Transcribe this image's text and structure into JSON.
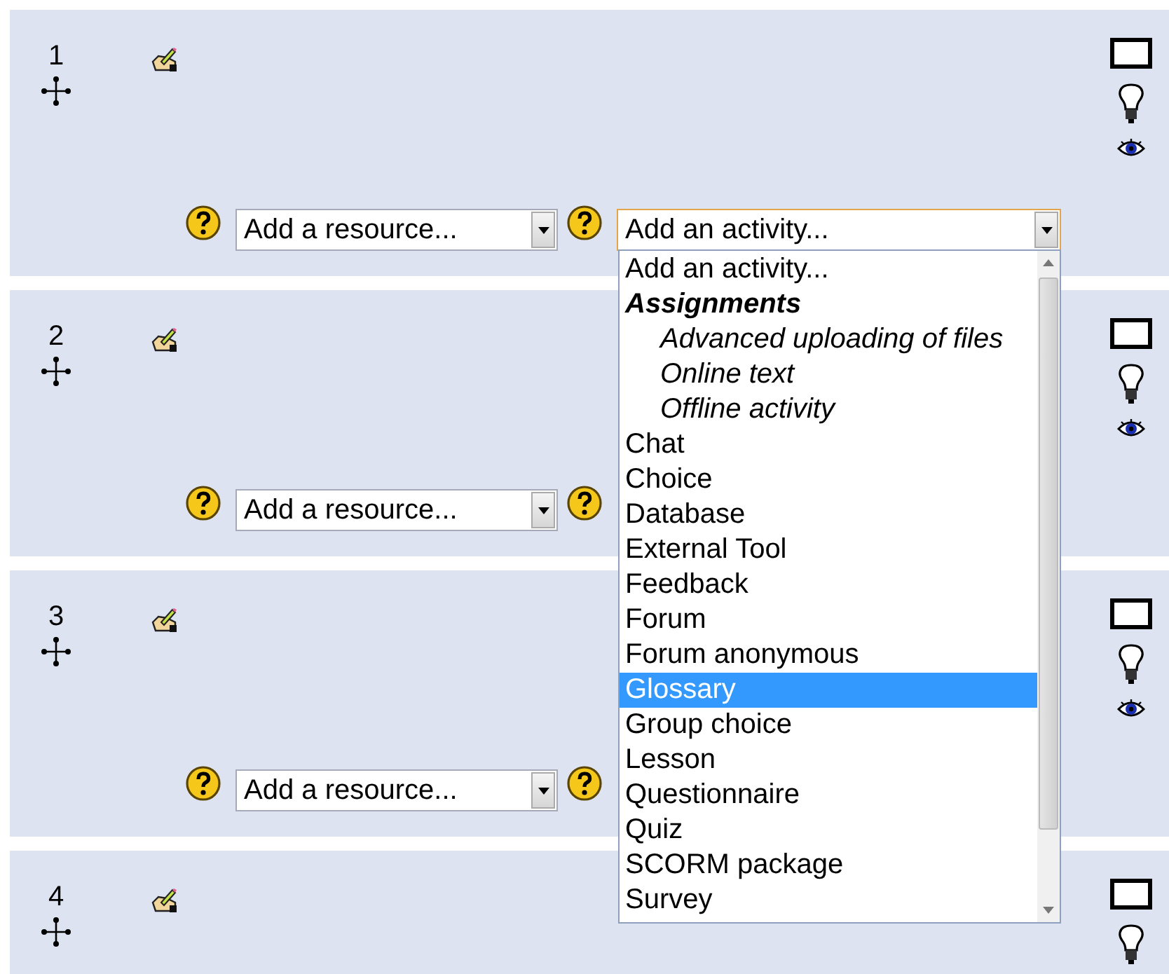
{
  "sections": [
    {
      "number": "1",
      "resource_select": {
        "value": "Add a resource..."
      },
      "activity_select": {
        "value": "Add an activity...",
        "focused": true
      }
    },
    {
      "number": "2",
      "resource_select": {
        "value": "Add a resource..."
      }
    },
    {
      "number": "3",
      "resource_select": {
        "value": "Add a resource..."
      }
    },
    {
      "number": "4"
    }
  ],
  "activity_list": {
    "items": [
      {
        "label": "Add an activity...",
        "kind": "option",
        "selected": false
      },
      {
        "label": "Assignments",
        "kind": "group",
        "selected": false
      },
      {
        "label": "Advanced uploading of files",
        "kind": "suboption",
        "selected": false
      },
      {
        "label": "Online text",
        "kind": "suboption",
        "selected": false
      },
      {
        "label": "Offline activity",
        "kind": "suboption",
        "selected": false
      },
      {
        "label": "Chat",
        "kind": "option",
        "selected": false
      },
      {
        "label": "Choice",
        "kind": "option",
        "selected": false
      },
      {
        "label": "Database",
        "kind": "option",
        "selected": false
      },
      {
        "label": "External Tool",
        "kind": "option",
        "selected": false
      },
      {
        "label": "Feedback",
        "kind": "option",
        "selected": false
      },
      {
        "label": "Forum",
        "kind": "option",
        "selected": false
      },
      {
        "label": "Forum anonymous",
        "kind": "option",
        "selected": false
      },
      {
        "label": "Glossary",
        "kind": "option",
        "selected": true
      },
      {
        "label": "Group choice",
        "kind": "option",
        "selected": false
      },
      {
        "label": "Lesson",
        "kind": "option",
        "selected": false
      },
      {
        "label": "Questionnaire",
        "kind": "option",
        "selected": false
      },
      {
        "label": "Quiz",
        "kind": "option",
        "selected": false
      },
      {
        "label": "SCORM package",
        "kind": "option",
        "selected": false
      },
      {
        "label": "Survey",
        "kind": "option",
        "selected": false
      }
    ]
  }
}
